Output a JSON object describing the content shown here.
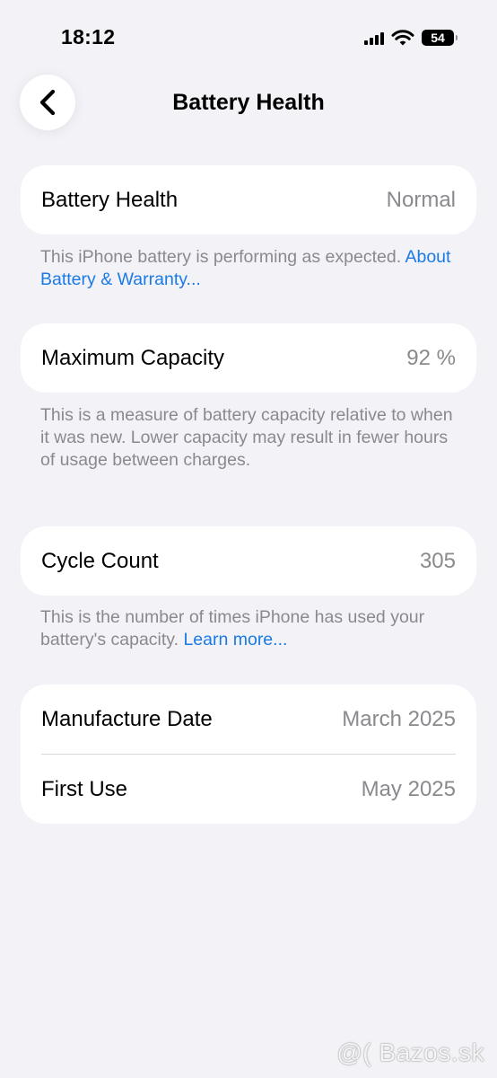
{
  "status_bar": {
    "time": "18:12",
    "battery_level": "54",
    "icons": [
      "cellular-signal-icon",
      "wifi-icon",
      "battery-icon"
    ]
  },
  "nav": {
    "back_icon": "chevron-left-icon",
    "title": "Battery Health"
  },
  "sections": {
    "health": {
      "label": "Battery Health",
      "value": "Normal",
      "footnote_text": "This iPhone battery is performing as expected. ",
      "footnote_link": "About Battery & Warranty..."
    },
    "capacity": {
      "label": "Maximum Capacity",
      "value": "92 %",
      "footnote_text": "This is a measure of battery capacity relative to when it was new. Lower capacity may result in fewer hours of usage between charges."
    },
    "cycles": {
      "label": "Cycle Count",
      "value": "305",
      "footnote_text": "This is the number of times iPhone has used your battery's capacity. ",
      "footnote_link": "Learn more..."
    },
    "dates": {
      "manufacture_label": "Manufacture Date",
      "manufacture_value": "March 2025",
      "first_use_label": "First Use",
      "first_use_value": "May 2025"
    }
  },
  "watermark": "@( Bazos.sk",
  "colors": {
    "background": "#f2f2f7",
    "card": "#ffffff",
    "secondary_text": "#8a8a8e",
    "link": "#1a7ae6"
  }
}
